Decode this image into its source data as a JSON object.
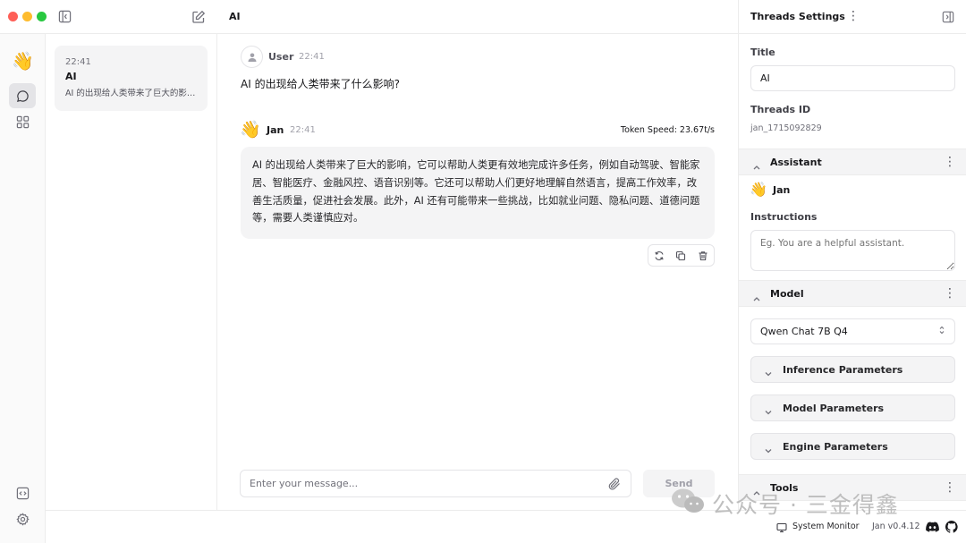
{
  "window": {
    "traffic_lights": [
      "#fe5f57",
      "#febc2e",
      "#28c840"
    ]
  },
  "header": {
    "thread_title": "AI"
  },
  "left_nav": {
    "logo_emoji": "👋"
  },
  "thread_list": [
    {
      "time": "22:41",
      "title": "AI",
      "snippet": "AI 的出现给人类带来了巨大的影响，它可以帮助人类更有效地完成许多任务"
    }
  ],
  "chat": {
    "user_msg": {
      "author": "User",
      "time": "22:41",
      "text": "AI 的出现给人类带来了什么影响?"
    },
    "assistant_msg": {
      "emoji": "👋",
      "author": "Jan",
      "time": "22:41",
      "token_speed": "Token Speed: 23.67t/s",
      "text": "AI 的出现给人类带来了巨大的影响，它可以帮助人类更有效地完成许多任务，例如自动驾驶、智能家居、智能医疗、金融风控、语音识别等。它还可以帮助人们更好地理解自然语言，提高工作效率，改善生活质量，促进社会发展。此外，AI 还有可能带来一些挑战，比如就业问题、隐私问题、道德问题等，需要人类谨慎应对。"
    },
    "input_placeholder": "Enter your message...",
    "send_label": "Send"
  },
  "settings": {
    "header": "Threads Settings",
    "title_label": "Title",
    "title_value": "AI",
    "thread_id_label": "Threads ID",
    "thread_id_value": "jan_1715092829",
    "assistant_section": "Assistant",
    "assistant_emoji": "👋",
    "assistant_name": "Jan",
    "instructions_label": "Instructions",
    "instructions_placeholder": "Eg. You are a helpful assistant.",
    "model_section": "Model",
    "model_value": "Qwen Chat 7B Q4",
    "inference_params": "Inference Parameters",
    "model_params": "Model Parameters",
    "engine_params": "Engine Parameters",
    "tools_section": "Tools"
  },
  "status_bar": {
    "system_monitor": "System Monitor",
    "version": "Jan v0.4.12"
  },
  "watermark": {
    "text": "公众号 · 三金得鑫"
  }
}
